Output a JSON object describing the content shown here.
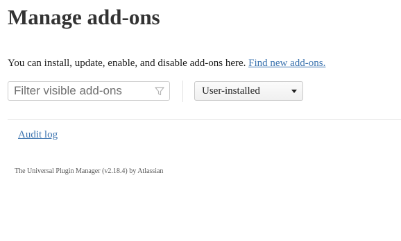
{
  "header": {
    "title": "Manage add-ons"
  },
  "intro": {
    "text": "You can install, update, enable, and disable add-ons here.",
    "link_label": "Find new add-ons."
  },
  "toolbar": {
    "filter": {
      "placeholder": "Filter visible add-ons",
      "value": "",
      "icon": "filter-funnel-icon"
    },
    "view_select": {
      "selected": "User-installed",
      "icon": "caret-down-icon"
    }
  },
  "links": {
    "audit_log": "Audit log"
  },
  "footer": {
    "text": "The Universal Plugin Manager (v2.18.4) by Atlassian"
  },
  "colors": {
    "link": "#3b73af",
    "title": "#333333",
    "border": "#cccccc"
  }
}
